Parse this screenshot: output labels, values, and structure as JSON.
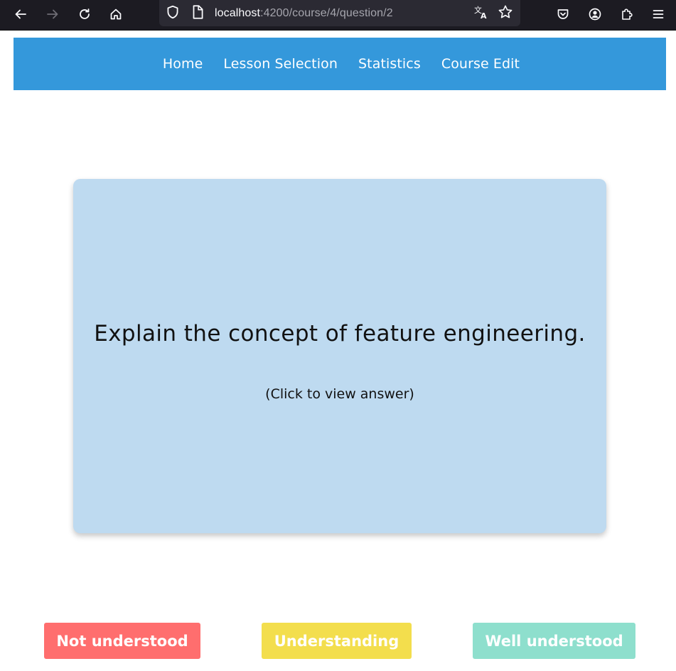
{
  "browser": {
    "url_host": "localhost",
    "url_path": ":4200/course/4/question/2",
    "icons": {
      "back": "back-arrow-icon",
      "forward": "forward-arrow-icon",
      "reload": "reload-icon",
      "home": "home-icon",
      "shield": "shield-icon",
      "page": "page-icon",
      "translate": "translate-icon",
      "bookmark": "star-icon",
      "pocket": "pocket-icon",
      "account": "account-icon",
      "extensions": "puzzle-icon",
      "menu": "hamburger-menu-icon"
    }
  },
  "nav": {
    "items": [
      {
        "label": "Home"
      },
      {
        "label": "Lesson Selection"
      },
      {
        "label": "Statistics"
      },
      {
        "label": "Course Edit"
      }
    ]
  },
  "card": {
    "question": "Explain the concept of feature engineering.",
    "hint": "(Click to view answer)"
  },
  "ratings": {
    "not_understood": "Not understood",
    "understanding": "Understanding",
    "well_understood": "Well understood"
  },
  "colors": {
    "nav_bg": "#3498db",
    "card_bg": "#bedaf0",
    "not_understood": "#ff6e6e",
    "understanding": "#f3de4d",
    "well_understood": "#8edfcd"
  }
}
